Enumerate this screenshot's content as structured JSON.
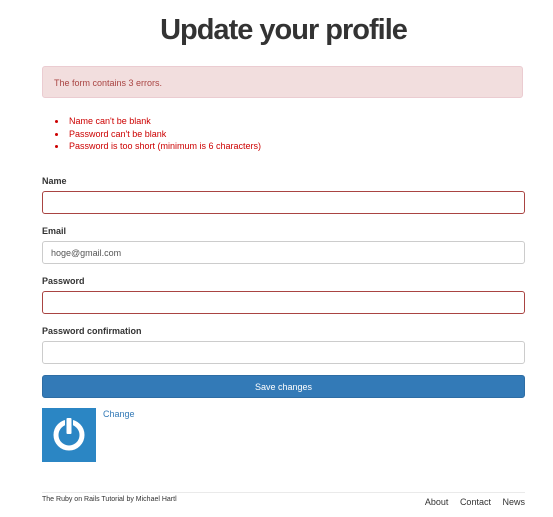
{
  "header": {
    "title": "Update your profile"
  },
  "alert": {
    "message": "The form contains 3 errors.",
    "color": "#a94442",
    "background": "#f2dede"
  },
  "errors": [
    "Name can't be blank",
    "Password can't be blank",
    "Password is too short (minimum is 6 characters)"
  ],
  "form": {
    "name": {
      "label": "Name",
      "value": "",
      "has_error": true
    },
    "email": {
      "label": "Email",
      "value": "hoge@gmail.com",
      "has_error": false
    },
    "password": {
      "label": "Password",
      "value": "",
      "has_error": true
    },
    "password_confirmation": {
      "label": "Password confirmation",
      "value": "",
      "has_error": false
    },
    "submit_label": "Save changes",
    "submit_color": "#337ab7"
  },
  "gravatar": {
    "icon": "gravatar-logo-icon",
    "change_label": "Change"
  },
  "footer": {
    "credit_prefix": "The ",
    "credit_link": "Ruby on Rails Tutorial",
    "credit_by": " by ",
    "credit_author": "Michael Hartl",
    "nav": [
      "About",
      "Contact",
      "News"
    ]
  }
}
